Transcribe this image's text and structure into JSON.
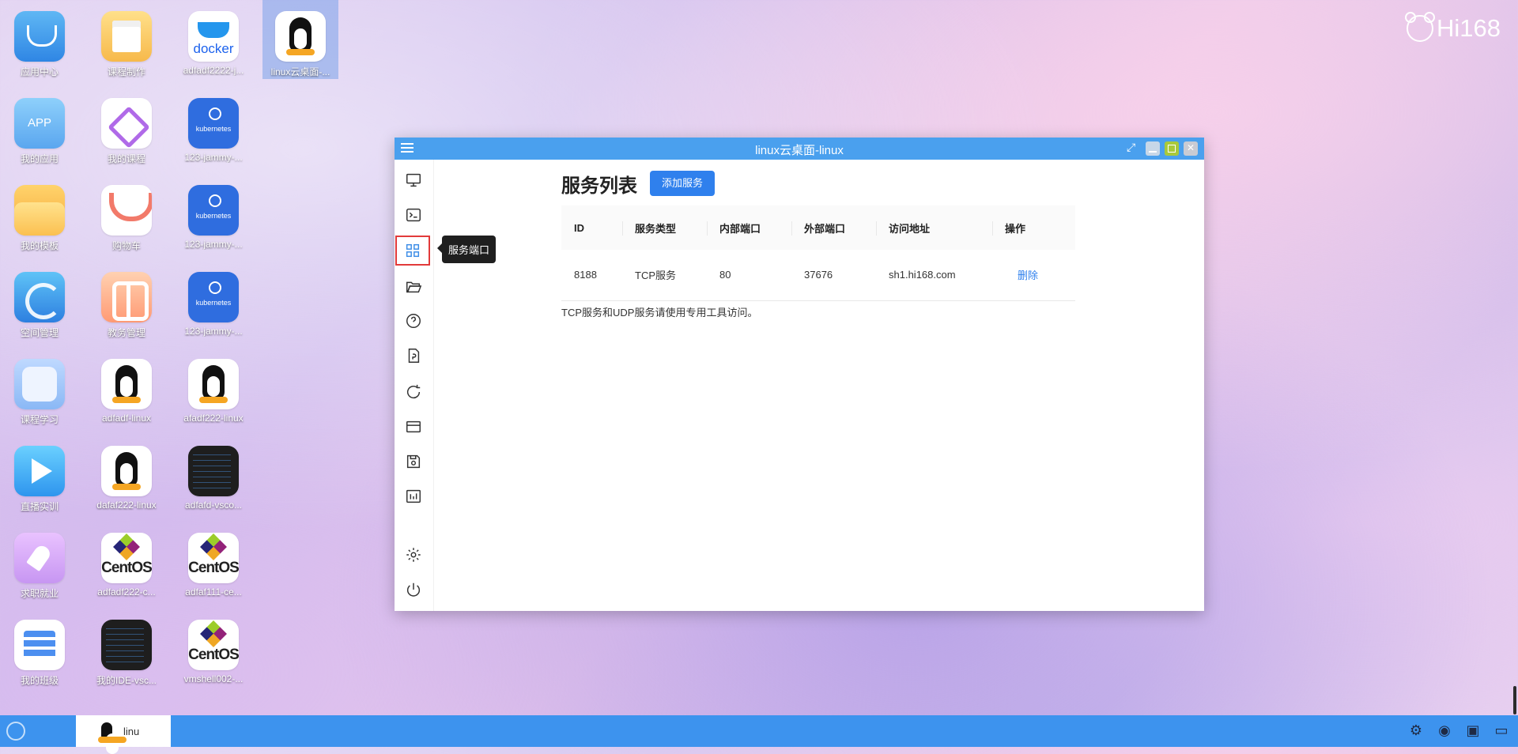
{
  "brand": "Hi168",
  "desktop_icons": [
    {
      "label": "应用中心",
      "art": "appcenter"
    },
    {
      "label": "课程制作",
      "art": "course"
    },
    {
      "label": "adfadf2222-j...",
      "art": "docker"
    },
    {
      "label": "linux云桌面-...",
      "art": "linux",
      "selected": true
    },
    {
      "label": "我的应用",
      "art": "app"
    },
    {
      "label": "我的课程",
      "art": "vs"
    },
    {
      "label": "123-jammy-...",
      "art": "k8s"
    },
    {
      "label": "我的模板",
      "art": "folder"
    },
    {
      "label": "购物车",
      "art": "cart"
    },
    {
      "label": "123-jammy-...",
      "art": "k8s"
    },
    {
      "label": "空间管理",
      "art": "space"
    },
    {
      "label": "教务管理",
      "art": "edu"
    },
    {
      "label": "123-jammy-...",
      "art": "k8s"
    },
    {
      "label": "课程学习",
      "art": "study"
    },
    {
      "label": "adfadf-linux",
      "art": "linux"
    },
    {
      "label": "afadf222-linux",
      "art": "linux"
    },
    {
      "label": "直播实训",
      "art": "live"
    },
    {
      "label": "dafaf222-linux",
      "art": "linux"
    },
    {
      "label": "adfafd-vsco...",
      "art": "code"
    },
    {
      "label": "求职就业",
      "art": "job"
    },
    {
      "label": "adfadf222-c...",
      "art": "centos"
    },
    {
      "label": "adfaf111-ce...",
      "art": "centos"
    },
    {
      "label": "我的班级",
      "art": "class"
    },
    {
      "label": "我的IDE-vsc...",
      "art": "code"
    },
    {
      "label": "vmshell002-...",
      "art": "centos"
    }
  ],
  "docker_text": "docker",
  "k8s_text": "kubernetes",
  "centos_text": "CentOS",
  "app_text": "APP",
  "window": {
    "title": "linux云桌面-linux",
    "tooltip": "服务端口",
    "sidebar_icons": [
      "monitor-icon",
      "terminal-icon",
      "grid-icon",
      "folder-open-icon",
      "help-icon",
      "document-icon",
      "refresh-icon",
      "card-icon",
      "save-icon",
      "chart-icon",
      "gear-icon",
      "power-icon"
    ]
  },
  "services": {
    "title": "服务列表",
    "add_button": "添加服务",
    "columns": [
      "ID",
      "服务类型",
      "内部端口",
      "外部端口",
      "访问地址",
      "操作"
    ],
    "rows": [
      {
        "id": "8188",
        "type": "TCP服务",
        "internal": "80",
        "external": "37676",
        "address": "sh1.hi168.com",
        "action": "删除"
      }
    ],
    "note": "TCP服务和UDP服务请使用专用工具访问。"
  },
  "taskbar": {
    "task_label": "linu",
    "tray_icons": [
      "gear-icon",
      "wechat-icon",
      "message-icon",
      "display-icon"
    ]
  },
  "colors": {
    "accent": "#2f80ed",
    "taskbar": "#3d93ee",
    "titlebar": "#4aa0ee"
  }
}
